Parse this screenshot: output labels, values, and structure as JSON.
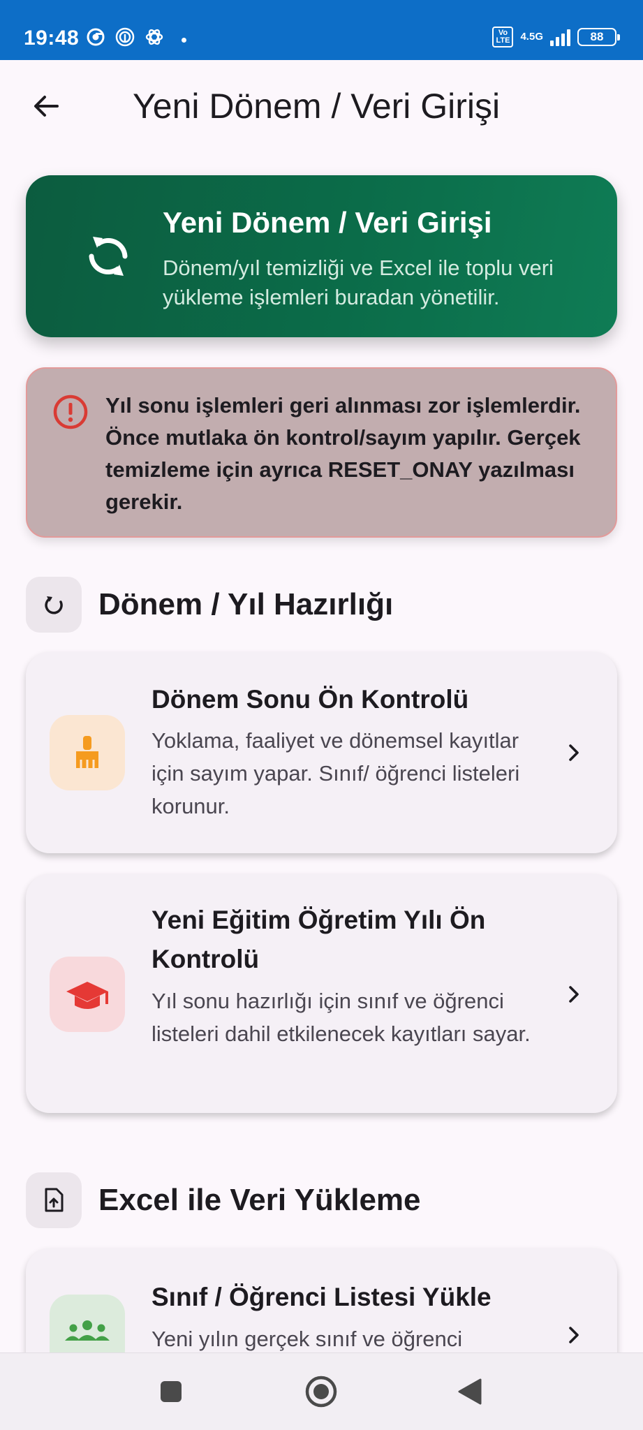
{
  "status_bar": {
    "time": "19:48",
    "volte": "Vo LTE",
    "network": "4.5G",
    "battery": "88"
  },
  "app_bar": {
    "title": "Yeni Dönem / Veri Girişi"
  },
  "hero": {
    "title": "Yeni Dönem / Veri Girişi",
    "description": "Dönem/yıl temizliği ve Excel ile toplu veri yükleme işlemleri buradan yönetilir.",
    "icon": "refresh-icon"
  },
  "warning": {
    "icon": "error-outline-icon",
    "text": "Yıl sonu işlemleri geri alınması zor işlemlerdir. Önce mutlaka ön kontrol/sayım yapılır. Gerçek temizleme için ayrıca RESET_ONAY yazılması gerekir."
  },
  "sections": {
    "period": {
      "title": "Dönem / Yıl Hazırlığı",
      "icon": "refresh-icon",
      "cards": [
        {
          "title": "Dönem Sonu Ön Kontrolü",
          "description": "Yoklama, faaliyet ve dönemsel kayıtlar için sayım yapar. Sınıf/ öğrenci listeleri korunur.",
          "icon": "broom-icon",
          "icon_color": "#f59b1f",
          "icon_bg": "#fbe6d2"
        },
        {
          "title": "Yeni Eğitim Öğretim Yılı Ön Kontrolü",
          "description": "Yıl sonu hazırlığı için sınıf ve öğrenci listeleri dahil etkilenecek kayıtları sayar.",
          "icon": "graduation-cap-icon",
          "icon_color": "#e53935",
          "icon_bg": "#f8d9dc"
        }
      ]
    },
    "excel": {
      "title": "Excel ile Veri Yükleme",
      "icon": "file-upload-icon",
      "cards": [
        {
          "title": "Sınıf / Öğrenci Listesi Yükle",
          "description": "Yeni yılın gerçek sınıf ve öğrenci",
          "icon": "group-icon",
          "icon_color": "#43a047",
          "icon_bg": "#dcebdc"
        }
      ]
    }
  },
  "colors": {
    "hero_start": "#0c5c3f",
    "hero_end": "#0f7c55",
    "warning_bg": "#c2adaf",
    "status_bar": "#0d6ec7"
  }
}
